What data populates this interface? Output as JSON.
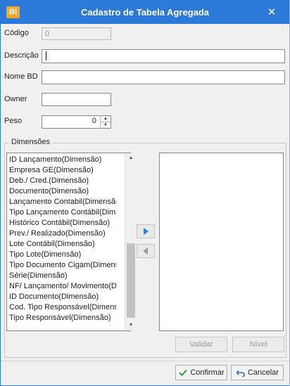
{
  "window": {
    "app_icon": "BI",
    "title": "Cadastro de Tabela Agregada",
    "close_glyph": "✕"
  },
  "form": {
    "codigo_label": "Código",
    "codigo_value": "0",
    "descricao_label": "Descrição",
    "descricao_value": "",
    "nome_bd_label": "Nome BD",
    "nome_bd_value": "",
    "owner_label": "Owner",
    "owner_value": "",
    "peso_label": "Peso",
    "peso_value": "0"
  },
  "dimensoes": {
    "group_label": "Dimensões",
    "available": [
      "ID  Lançamento(Dimensão)",
      "Empresa GE(Dimensão)",
      "Deb./ Cred.(Dimensão)",
      "Documento(Dimensão)",
      "Lançamento  Contabil(Dimensão)",
      "Tipo  Lançamento  Contábil(Dimensão)",
      "Histórico  Contábil(Dimensão)",
      "Prev./ Realizado(Dimensão)",
      "Lote  Contábil(Dimensão)",
      "Tipo  Lote(Dimensão)",
      "Tipo  Documento  Cigam(Dimensão)",
      "Série(Dimensão)",
      "NF/ Lançamento/ Movimento(Dimensão)",
      "ID  Documento(Dimensão)",
      "Cod. Tipo Responsável(Dimensão)",
      "Tipo Responsável(Dimensão)"
    ],
    "selected": [],
    "validar_label": "Validar",
    "nivel_label": "Nível"
  },
  "footer": {
    "confirmar_label": "Confirmar",
    "cancelar_label": "Cancelar"
  },
  "colors": {
    "titlebar": "#2b79d8",
    "accent_arrow": "#2f7fd6",
    "confirm_check": "#2e9d3a",
    "cancel_icon": "#2f6fc4"
  },
  "icons": {
    "move_right": "arrow-right-icon",
    "move_left": "arrow-left-icon",
    "confirm": "check-icon",
    "cancel": "undo-icon"
  }
}
